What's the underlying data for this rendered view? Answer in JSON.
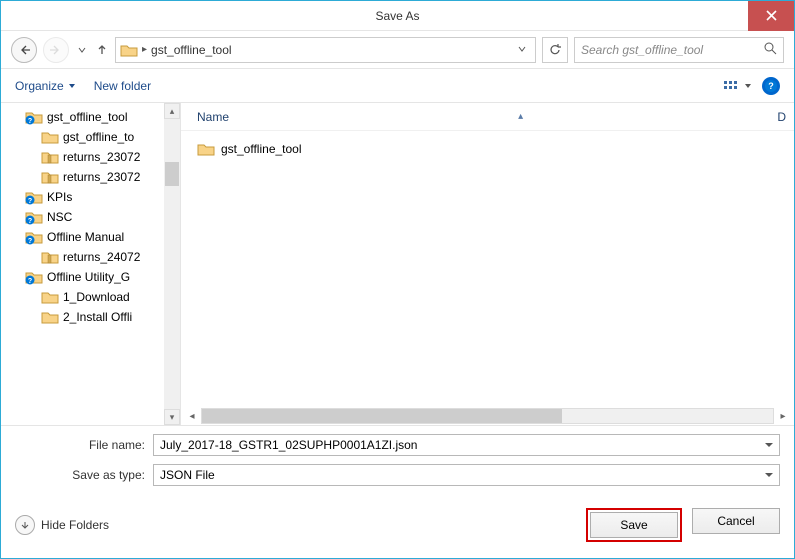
{
  "title": "Save As",
  "breadcrumb": {
    "current": "gst_offline_tool"
  },
  "search": {
    "placeholder": "Search gst_offline_tool"
  },
  "command_bar": {
    "organize": "Organize",
    "new_folder": "New folder"
  },
  "tree": {
    "items": [
      {
        "label": "gst_offline_tool",
        "kind": "help-folder",
        "level": 1
      },
      {
        "label": "gst_offline_to",
        "kind": "folder",
        "level": 2
      },
      {
        "label": "returns_23072",
        "kind": "zip",
        "level": 2
      },
      {
        "label": "returns_23072",
        "kind": "zip",
        "level": 2
      },
      {
        "label": "KPIs",
        "kind": "help-folder",
        "level": 1
      },
      {
        "label": "NSC",
        "kind": "help-folder",
        "level": 1
      },
      {
        "label": "Offline Manual",
        "kind": "help-folder",
        "level": 1
      },
      {
        "label": "returns_24072",
        "kind": "zip",
        "level": 2
      },
      {
        "label": "Offline Utility_G",
        "kind": "help-folder",
        "level": 1
      },
      {
        "label": "1_Download",
        "kind": "folder",
        "level": 2
      },
      {
        "label": "2_Install Offli",
        "kind": "folder",
        "level": 2
      }
    ]
  },
  "list": {
    "columns": {
      "name": "Name",
      "right": "D"
    },
    "items": [
      {
        "label": "gst_offline_tool"
      }
    ]
  },
  "form": {
    "filename_label": "File name:",
    "filename_value": "July_2017-18_GSTR1_02SUPHP0001A1ZI.json",
    "savetype_label": "Save as type:",
    "savetype_value": "JSON File"
  },
  "footer": {
    "hide_folders": "Hide Folders",
    "save": "Save",
    "cancel": "Cancel"
  }
}
